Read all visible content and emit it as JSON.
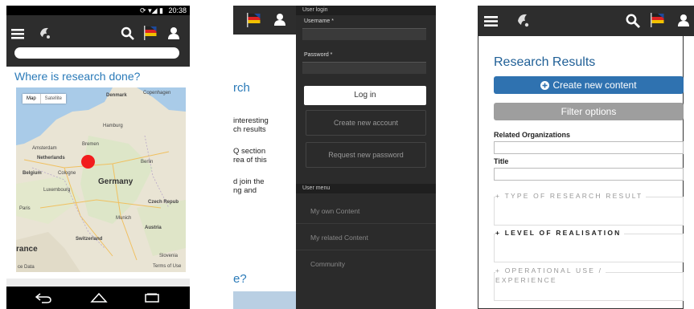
{
  "phone1": {
    "status_time": "20:38",
    "search_placeholder": "",
    "heading": "Where is research done?",
    "map": {
      "type_map": "Map",
      "type_satellite": "Satellite",
      "labels": {
        "denmark": "Denmark",
        "copenhagen": "Copenhagen",
        "hamburg": "Hamburg",
        "bremen": "Bremen",
        "amsterdam": "Amsterdam",
        "netherlands": "Netherlands",
        "berlin": "Berlin",
        "belgium": "Belgium",
        "cologne": "Cologne",
        "germany": "Germany",
        "luxembourg": "Luxembourg",
        "czech": "Czech Repub",
        "paris": "Paris",
        "munich": "Munich",
        "austria": "Austria",
        "switzerland": "Switzerland",
        "france": "rance",
        "slovenia": "Slovenia",
        "mapdata": "ce Data",
        "terms": "Terms of Use"
      }
    }
  },
  "phone2": {
    "page": {
      "heading": "rch",
      "lines": [
        "interesting",
        "ch results",
        "Q section",
        "rea of this",
        "d join the",
        "ng and"
      ],
      "bottom": "e?"
    },
    "drawer": {
      "login_header": "User login",
      "username_label": "Username *",
      "password_label": "Password *",
      "login_button": "Log in",
      "create_account": "Create new account",
      "request_password": "Request new password",
      "menu_header": "User menu",
      "menu_items": [
        "My own Content",
        "My related Content",
        "Community"
      ]
    }
  },
  "phone3": {
    "title": "Research Results",
    "create_button": "Create new content",
    "filter_button": "Filter options",
    "field_org": "Related Organizations",
    "field_title": "Title",
    "section1": "+ TYPE OF RESEARCH RESULT",
    "section2": "+ LEVEL OF REALISATION",
    "section3_line1": "+ OPERATIONAL USE /",
    "section3_line2": "EXPERIENCE"
  },
  "colors": {
    "topbar": "#2d2d2d",
    "heading_blue": "#2a7ab8",
    "button_blue": "#2f72b0",
    "button_grey": "#9e9e9e",
    "marker_red": "#f21d1d"
  },
  "icons": [
    "hamburger-menu-icon",
    "logo-icon",
    "search-icon",
    "language-flag-icon",
    "user-icon",
    "wifi-icon",
    "signal-icon",
    "battery-icon",
    "back-icon",
    "home-icon",
    "recent-apps-icon",
    "plus-circle-icon"
  ]
}
